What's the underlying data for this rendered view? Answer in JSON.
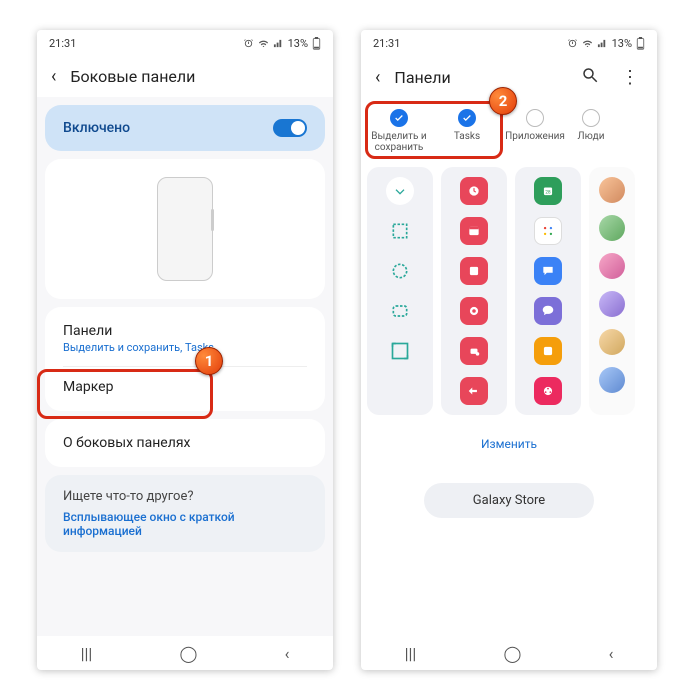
{
  "status": {
    "time": "21:31",
    "battery": "13%"
  },
  "left": {
    "title": "Боковые панели",
    "enabled_label": "Включено",
    "panels_title": "Панели",
    "panels_sub": "Выделить и сохранить, Tasks",
    "marker": "Маркер",
    "about": "О боковых панелях",
    "footer_q": "Ищете что-то другое?",
    "footer_link": "Всплывающее окно с краткой информацией",
    "badge": "1"
  },
  "right": {
    "title": "Панели",
    "badge": "2",
    "tabs": [
      {
        "label": "Выделить и сохранить",
        "checked": true
      },
      {
        "label": "Tasks",
        "checked": true
      },
      {
        "label": "Приложения",
        "checked": false
      },
      {
        "label": "Люди",
        "checked": false
      }
    ],
    "edit": "Изменить",
    "store": "Galaxy Store"
  }
}
